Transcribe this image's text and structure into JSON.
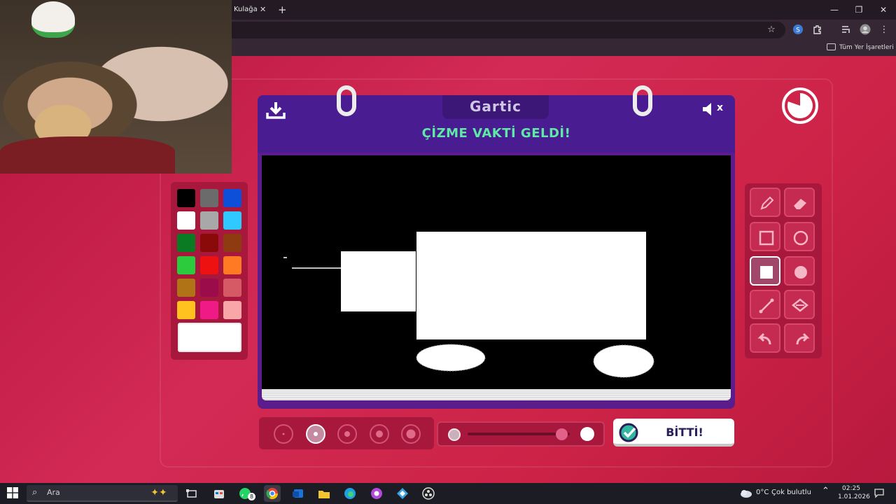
{
  "browser": {
    "tab_title": "Kulağa",
    "tab_close": "✕",
    "new_tab": "+",
    "window_controls": [
      "—",
      "❐",
      "✕"
    ],
    "bookmarks_label": "Tüm Yer İşaretleri"
  },
  "game": {
    "logo": "Gartic",
    "title": "ÇİZME VAKTİ GELDİ!",
    "done_label": "BİTTİ!",
    "mute_suffix": "x",
    "palette": [
      "#000000",
      "#6b6b6b",
      "#0d4fd8",
      "#ffffff",
      "#a8a8a8",
      "#30c9ff",
      "#0a7a23",
      "#8a0a0a",
      "#8f3b12",
      "#2ccb3d",
      "#ee1111",
      "#ff7a23",
      "#b07416",
      "#9a0d4a",
      "#d65a66",
      "#ffc21f",
      "#f01a86",
      "#f8a6a8"
    ],
    "selected_color": "#ffffff",
    "tools": [
      "pencil",
      "eraser",
      "rectangle",
      "circle",
      "filled-rectangle",
      "filled-circle",
      "line",
      "fill",
      "undo",
      "redo"
    ],
    "selected_tool": "filled-rectangle",
    "brush_sizes": 5,
    "selected_brush_size": 2,
    "opacity": 0.92
  },
  "taskbar": {
    "search_placeholder": "Ara",
    "weather_temp": "0°C",
    "weather_desc": "Çok bulutlu",
    "time": "02:25",
    "date": "1.01.2026",
    "whatsapp_badge": "8"
  }
}
